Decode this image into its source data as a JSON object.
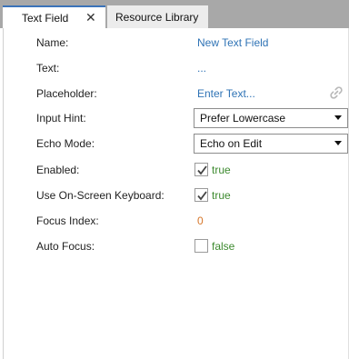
{
  "tabs": [
    {
      "label": "Text Field",
      "active": true
    },
    {
      "label": "Resource Library",
      "active": false
    }
  ],
  "tab_close_glyph": "✕",
  "properties": {
    "name": {
      "label": "Name:",
      "value": "New Text Field"
    },
    "text": {
      "label": "Text:",
      "value": "..."
    },
    "placeholder": {
      "label": "Placeholder:",
      "value": "Enter Text...",
      "icon": "link-icon"
    },
    "input_hint": {
      "label": "Input Hint:",
      "value": "Prefer Lowercase"
    },
    "echo_mode": {
      "label": "Echo Mode:",
      "value": "Echo on Edit"
    },
    "enabled": {
      "label": "Enabled:",
      "checked": true,
      "value": "true"
    },
    "use_onscreen_keyboard": {
      "label": "Use On-Screen Keyboard:",
      "checked": true,
      "value": "true"
    },
    "focus_index": {
      "label": "Focus Index:",
      "value": "0"
    },
    "auto_focus": {
      "label": "Auto Focus:",
      "checked": false,
      "value": "false"
    }
  },
  "colors": {
    "accent": "#3b73b9",
    "link": "#2f73b5",
    "boolean": "#3d8a2f",
    "number": "#d6762a",
    "tabbar": "#a8a8a8"
  }
}
